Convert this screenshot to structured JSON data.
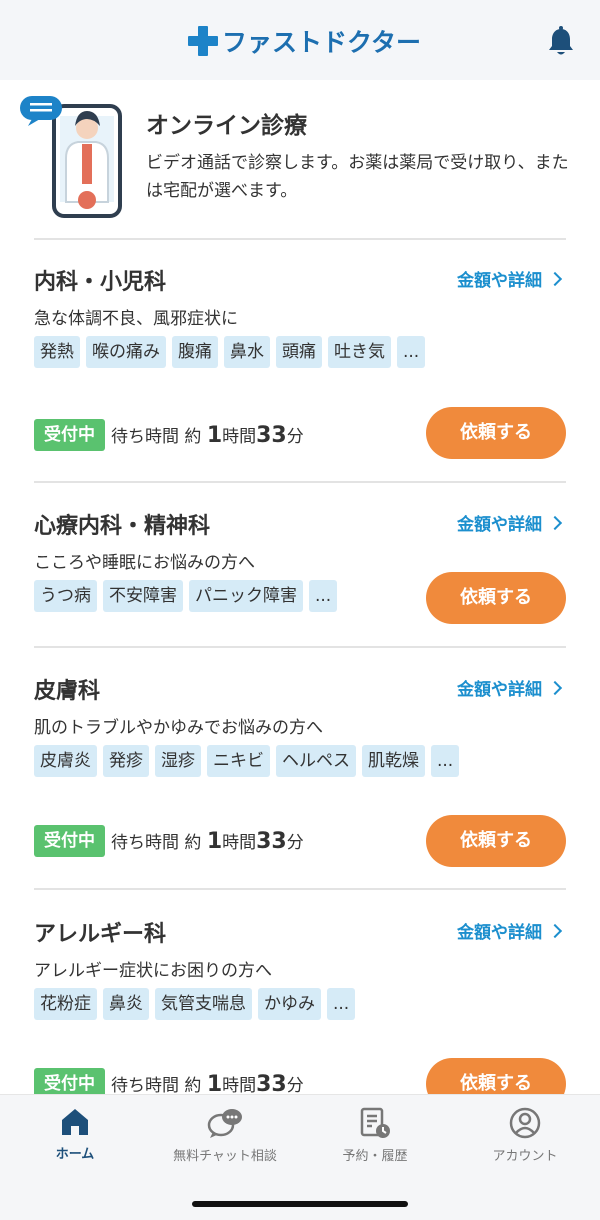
{
  "header": {
    "app_name": "ファストドクター"
  },
  "intro": {
    "title": "オンライン診療",
    "description": "ビデオ通話で診察します。お薬は薬局で受け取り、または宅配が選べます。"
  },
  "departments": [
    {
      "name": "内科・小児科",
      "link": "金額や詳細",
      "subtitle": "急な体調不良、風邪症状に",
      "tags": [
        "発熱",
        "喉の痛み",
        "腹痛",
        "鼻水",
        "頭痛",
        "吐き気",
        "..."
      ],
      "status": "受付中",
      "wait_prefix": "待ち時間 約 ",
      "wait_hour": "1",
      "wait_hour_unit": "時間",
      "wait_min": "33",
      "wait_min_unit": "分",
      "button": "依頼する"
    },
    {
      "name": "心療内科・精神科",
      "link": "金額や詳細",
      "subtitle": "こころや睡眠にお悩みの方へ",
      "tags": [
        "うつ病",
        "不安障害",
        "パニック障害",
        "..."
      ],
      "button": "依頼する"
    },
    {
      "name": "皮膚科",
      "link": "金額や詳細",
      "subtitle": "肌のトラブルやかゆみでお悩みの方へ",
      "tags": [
        "皮膚炎",
        "発疹",
        "湿疹",
        "ニキビ",
        "ヘルペス",
        "肌乾燥",
        "..."
      ],
      "status": "受付中",
      "wait_prefix": "待ち時間 約 ",
      "wait_hour": "1",
      "wait_hour_unit": "時間",
      "wait_min": "33",
      "wait_min_unit": "分",
      "button": "依頼する"
    },
    {
      "name": "アレルギー科",
      "link": "金額や詳細",
      "subtitle": "アレルギー症状にお困りの方へ",
      "tags": [
        "花粉症",
        "鼻炎",
        "気管支喘息",
        "かゆみ",
        "..."
      ],
      "status": "受付中",
      "wait_prefix": "待ち時間 約 ",
      "wait_hour": "1",
      "wait_hour_unit": "時間",
      "wait_min": "33",
      "wait_min_unit": "分",
      "button": "依頼する"
    }
  ],
  "bottom_nav": {
    "home": "ホーム",
    "chat": "無料チャット相談",
    "history": "予約・履歴",
    "account": "アカウント"
  },
  "colors": {
    "brand_blue": "#1d83c8",
    "link_blue": "#1c8fce",
    "accept_green": "#5ac26f",
    "request_orange": "#f08a3c",
    "tag_bg": "#d6ebf7"
  }
}
